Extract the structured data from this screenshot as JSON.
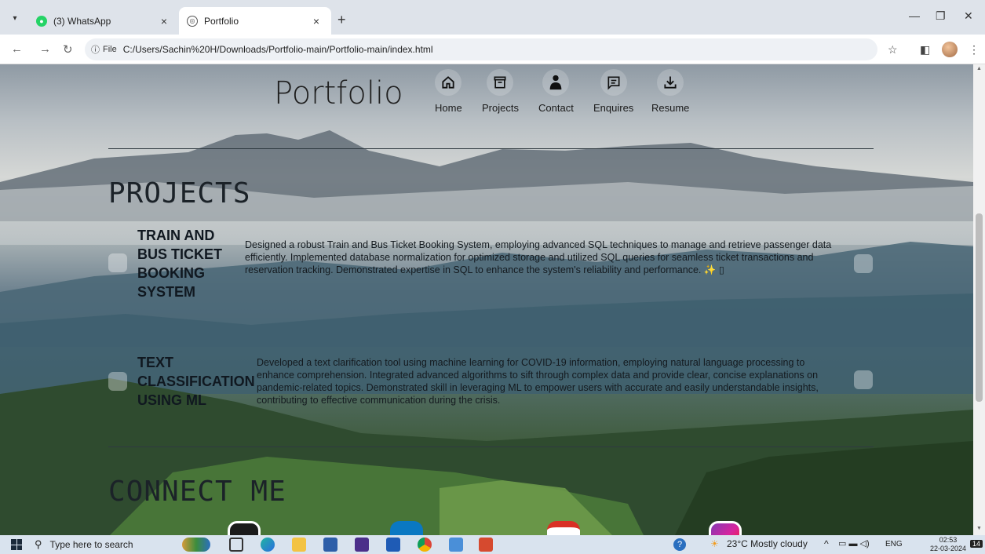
{
  "browser": {
    "tabs": [
      {
        "title": "(3) WhatsApp",
        "active": false
      },
      {
        "title": "Portfolio",
        "active": true
      }
    ],
    "address": {
      "chip": "File",
      "url": "C:/Users/Sachin%20H/Downloads/Portfolio-main/Portfolio-main/index.html"
    }
  },
  "site": {
    "logo": "Portfolio",
    "nav": [
      {
        "label": "Home",
        "icon": "home-icon"
      },
      {
        "label": "Projects",
        "icon": "archive-icon"
      },
      {
        "label": "Contact",
        "icon": "person-icon"
      },
      {
        "label": "Enquires",
        "icon": "message-icon"
      },
      {
        "label": "Resume",
        "icon": "download-icon"
      }
    ],
    "projects_heading": "PROJECTS",
    "projects": [
      {
        "title_lines": [
          "TRAIN AND",
          "BUS TICKET",
          "BOOKING",
          "SYSTEM"
        ],
        "desc_lines": [
          "Designed a robust Train and Bus Ticket Booking System, employing advanced SQL techniques to manage and retrieve passenger data",
          "efficiently. Implemented database normalization for optimized storage and utilized SQL queries for seamless ticket transactions and",
          "reservation tracking. Demonstrated expertise in SQL to enhance the system's reliability and performance. ✨ ▯"
        ]
      },
      {
        "title_lines": [
          "TEXT",
          "CLASSIFICATION",
          "USING ML"
        ],
        "desc_lines": [
          "Developed a text clarification tool using machine learning for COVID-19 information, employing natural language processing to",
          "enhance comprehension. Integrated advanced algorithms to sift through complex data and provide clear, concise explanations on",
          "pandemic-related topics. Demonstrated skill in leveraging ML to empower users with accurate and easily understandable insights,",
          "contributing to effective communication during the crisis."
        ]
      }
    ],
    "connect_heading": "CONNECT ME"
  },
  "taskbar": {
    "search_placeholder": "Type here to search",
    "weather": "23°C  Mostly cloudy",
    "lang": "ENG",
    "time": "02:53",
    "date": "22-03-2024",
    "notif_count": "14"
  },
  "colors": {
    "github": "#1b1b1b",
    "linkedin": "#0a78c2",
    "gmail": "#ffffff",
    "instagram": "#d6249f"
  }
}
